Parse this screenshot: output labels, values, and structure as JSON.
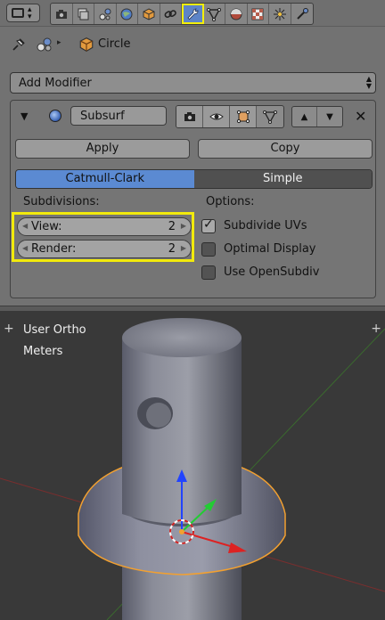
{
  "header": {
    "active_tab": "modifiers",
    "tabs": [
      "render",
      "render-layers",
      "scene",
      "world",
      "object",
      "constraints",
      "modifiers",
      "object-data",
      "material",
      "texture",
      "particles",
      "physics"
    ]
  },
  "breadcrumb": {
    "object_name": "Circle"
  },
  "add_modifier": {
    "label": "Add Modifier"
  },
  "modifier": {
    "name": "Subsurf",
    "apply_label": "Apply",
    "copy_label": "Copy",
    "algorithms": [
      "Catmull-Clark",
      "Simple"
    ],
    "selected_algorithm": "Catmull-Clark",
    "subdivisions_label": "Subdivisions:",
    "view": {
      "label": "View:",
      "value": "2"
    },
    "render": {
      "label": "Render:",
      "value": "2"
    },
    "options_label": "Options:",
    "options": [
      {
        "label": "Subdivide UVs",
        "checked": true
      },
      {
        "label": "Optimal Display",
        "checked": false
      },
      {
        "label": "Use OpenSubdiv",
        "checked": false
      }
    ]
  },
  "viewport": {
    "view_name": "User Ortho",
    "units": "Meters"
  },
  "colors": {
    "accent": "#5b8ad2",
    "highlight": "#f2ea0c",
    "selection_outline": "#f2a030"
  }
}
